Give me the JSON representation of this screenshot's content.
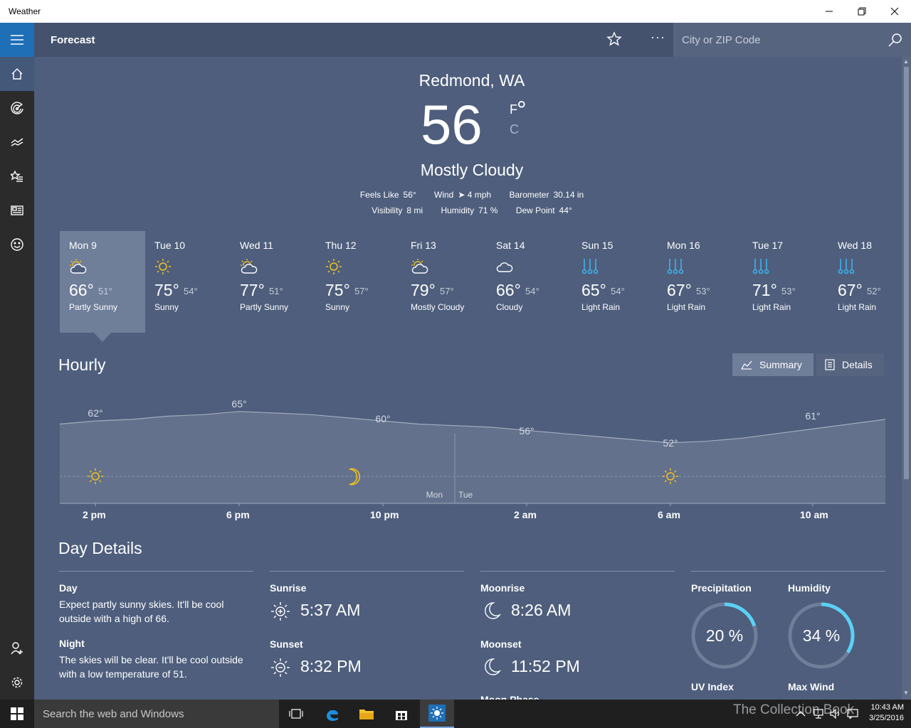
{
  "window": {
    "title": "Weather"
  },
  "header": {
    "title": "Forecast",
    "search_placeholder": "City or ZIP Code",
    "more": "···"
  },
  "current": {
    "city": "Redmond, WA",
    "temp": "56",
    "deg": "°",
    "unit_f": "F",
    "unit_c": "C",
    "condition": "Mostly Cloudy",
    "stats_row1": [
      {
        "label": "Feels Like",
        "value": "56°"
      },
      {
        "label": "Wind",
        "value": "➤ 4 mph"
      },
      {
        "label": "Barometer",
        "value": "30.14 in"
      }
    ],
    "stats_row2": [
      {
        "label": "Visibility",
        "value": "8 mi"
      },
      {
        "label": "Humidity",
        "value": "71 %"
      },
      {
        "label": "Dew Point",
        "value": "44°"
      }
    ]
  },
  "daily": [
    {
      "day": "Mon 9",
      "hi": "66°",
      "lo": "51°",
      "cond": "Partly Sunny",
      "icon": "partly-sunny-icon"
    },
    {
      "day": "Tue 10",
      "hi": "75°",
      "lo": "54°",
      "cond": "Sunny",
      "icon": "sunny-icon"
    },
    {
      "day": "Wed 11",
      "hi": "77°",
      "lo": "51°",
      "cond": "Partly Sunny",
      "icon": "partly-sunny-icon"
    },
    {
      "day": "Thu 12",
      "hi": "75°",
      "lo": "57°",
      "cond": "Sunny",
      "icon": "sunny-icon"
    },
    {
      "day": "Fri 13",
      "hi": "79°",
      "lo": "57°",
      "cond": "Mostly Cloudy",
      "icon": "partly-sunny-icon"
    },
    {
      "day": "Sat 14",
      "hi": "66°",
      "lo": "54°",
      "cond": "Cloudy",
      "icon": "cloudy-icon"
    },
    {
      "day": "Sun 15",
      "hi": "65°",
      "lo": "54°",
      "cond": "Light Rain",
      "icon": "light-rain-icon"
    },
    {
      "day": "Mon 16",
      "hi": "67°",
      "lo": "53°",
      "cond": "Light Rain",
      "icon": "light-rain-icon"
    },
    {
      "day": "Tue 17",
      "hi": "71°",
      "lo": "53°",
      "cond": "Light Rain",
      "icon": "light-rain-icon"
    },
    {
      "day": "Wed 18",
      "hi": "67°",
      "lo": "52°",
      "cond": "Light Rain",
      "icon": "light-rain-icon"
    }
  ],
  "hourly": {
    "title": "Hourly",
    "summary_label": "Summary",
    "details_label": "Details",
    "day_left": "Mon",
    "day_right": "Tue",
    "hour_labels": [
      "2 pm",
      "6 pm",
      "10 pm",
      "2 am",
      "6 am",
      "10 am"
    ],
    "temp_labels": [
      "62°",
      "65°",
      "60°",
      "56°",
      "52°",
      "61°"
    ]
  },
  "chart_data": {
    "type": "area",
    "x": [
      "1 pm",
      "2 pm",
      "3 pm",
      "4 pm",
      "5 pm",
      "6 pm",
      "7 pm",
      "8 pm",
      "9 pm",
      "10 pm",
      "11 pm",
      "12 am",
      "1 am",
      "2 am",
      "3 am",
      "4 am",
      "5 am",
      "6 am",
      "7 am",
      "8 am",
      "9 am",
      "10 am",
      "11 am",
      "12 pm"
    ],
    "values": [
      61,
      62,
      62.5,
      63.5,
      64,
      65,
      64.5,
      64,
      63,
      62,
      61,
      60.5,
      60,
      59,
      58,
      57,
      56,
      55,
      55.5,
      56.5,
      58,
      59.5,
      61,
      62.5
    ],
    "labeled_points": [
      {
        "x": "2 pm",
        "value": 62
      },
      {
        "x": "6 pm",
        "value": 65
      },
      {
        "x": "10 pm",
        "value": 60
      },
      {
        "x": "2 am",
        "value": 56
      },
      {
        "x": "6 am",
        "value": 52
      },
      {
        "x": "10 am",
        "value": 61
      }
    ],
    "title": "Hourly",
    "xlabel": "",
    "ylabel": ""
  },
  "details": {
    "title": "Day Details",
    "day_label": "Day",
    "day_text": "Expect partly sunny skies. It'll be cool outside with a high of 66.",
    "night_label": "Night",
    "night_text": "The skies will be clear. It'll be cool outside with a low temperature of 51.",
    "sunrise_label": "Sunrise",
    "sunrise": "5:37 AM",
    "sunset_label": "Sunset",
    "sunset": "8:32 PM",
    "moonrise_label": "Moonrise",
    "moonrise": "8:26 AM",
    "moonset_label": "Moonset",
    "moonset": "11:52 PM",
    "moonphase_label": "Moon Phase",
    "precip_label": "Precipitation",
    "precip": "20 %",
    "precip_fraction": 0.2,
    "humidity_label": "Humidity",
    "humidity": "34 %",
    "humidity_fraction": 0.34,
    "uv_label": "UV Index",
    "maxwind_label": "Max Wind"
  },
  "taskbar": {
    "search_placeholder": "Search the web and Windows",
    "time": "10:43 AM",
    "date": "3/25/2016",
    "watermark": "The Collection Book"
  },
  "colors": {
    "accent": "#1e6fb6",
    "ring": "#5ad1f5",
    "sun": "#f3c21b",
    "rain": "#3fb1ea",
    "background": "#4e5e7c"
  }
}
